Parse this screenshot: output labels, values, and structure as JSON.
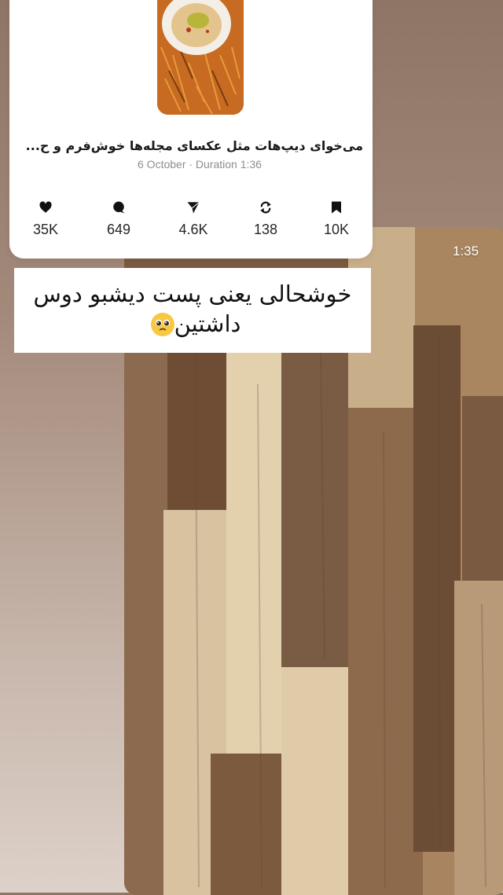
{
  "post": {
    "caption": "می‌خوای دیپ‌هات مثل عکسای مجله‌ها خوش‌فرم و ح...",
    "meta": "6 October · Duration 1:36",
    "stats": {
      "likes": "35K",
      "comments": "649",
      "shares": "4.6K",
      "reposts": "138",
      "saves": "10K"
    }
  },
  "video": {
    "timestamp": "1:35"
  },
  "sticker": {
    "text": "خوشحالی یعنی پست دیشبو دوس داشتین"
  },
  "icons": {
    "like": "heart-icon",
    "comment": "comment-bubble-icon",
    "share": "paper-plane-icon",
    "repost": "repost-arrows-icon",
    "save": "bookmark-icon",
    "emoji": "pleading-face-emoji"
  },
  "colors": {
    "background_top": "#8f7565",
    "background_bottom": "#ddd1c9",
    "card": "#ffffff",
    "meta_text": "#8e8e8e"
  }
}
